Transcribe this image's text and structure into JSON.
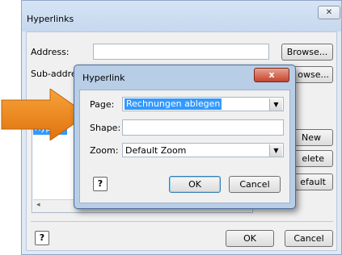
{
  "outer_dialog": {
    "title": "Hyperlinks",
    "close_glyph": "✕",
    "address_label": "Address:",
    "address_value": "",
    "subaddress_label": "Sub-addre",
    "browse1": "Browse...",
    "browse2": "owse...",
    "list_item": "Hyperlin",
    "new_button": "New",
    "delete_button": "elete",
    "default_button": "efault",
    "ok_button": "OK",
    "cancel_button": "Cancel",
    "help_glyph": "?"
  },
  "inner_dialog": {
    "title": "Hyperlink",
    "close_glyph": "x",
    "page_label": "Page:",
    "page_value": "Rechnungen ablegen",
    "shape_label": "Shape:",
    "shape_value": "",
    "zoom_label": "Zoom:",
    "zoom_value": "Default Zoom",
    "ok_button": "OK",
    "cancel_button": "Cancel",
    "help_glyph": "?"
  },
  "colors": {
    "arrow": "#f28c1a",
    "selection": "#3399ff"
  },
  "icons": [
    "close-icon",
    "help-icon",
    "chevron-down-icon",
    "pointer-arrow-icon"
  ]
}
